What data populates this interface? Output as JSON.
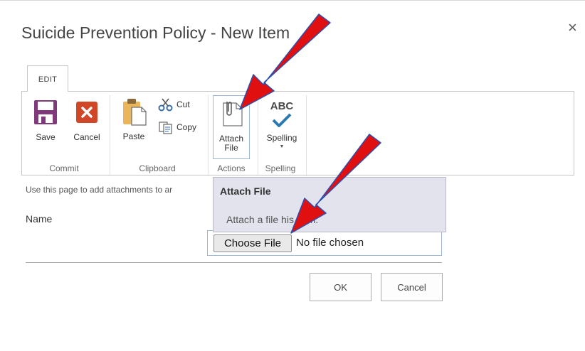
{
  "dialog": {
    "title": "Suicide Prevention Policy - New Item",
    "close_glyph": "×"
  },
  "ribbon": {
    "tab_label": "EDIT",
    "groups": {
      "commit": {
        "label": "Commit",
        "save_label": "Save",
        "cancel_label": "Cancel"
      },
      "clipboard": {
        "label": "Clipboard",
        "paste_label": "Paste",
        "cut_label": "Cut",
        "copy_label": "Copy"
      },
      "actions": {
        "label": "Actions",
        "attach_line1": "Attach",
        "attach_line2": "File"
      },
      "spelling": {
        "label": "Spelling",
        "button_label": "Spelling",
        "icon_text": "ABC"
      }
    }
  },
  "form": {
    "description": "Use this page to add attachments to ar",
    "name_label": "Name",
    "choose_file_label": "Choose File",
    "no_file_text": "No file chosen"
  },
  "tooltip": {
    "title": "Attach File",
    "body": "Attach a file    his item."
  },
  "buttons": {
    "ok_label": "OK",
    "cancel_label": "Cancel"
  },
  "colors": {
    "save_purple": "#80397b",
    "cancel_red": "#d04727",
    "check_blue": "#2a7ab0",
    "highlight_border": "#9bb6d6",
    "tooltip_bg": "#e3e3ed",
    "annotation_arrow": "#e01010"
  },
  "icons": {
    "save": "floppy-disk-icon",
    "cancel": "x-square-icon",
    "paste": "clipboard-icon",
    "cut": "scissors-icon",
    "copy": "copy-icon",
    "attach": "paperclip-document-icon",
    "spelling": "abc-check-icon",
    "close": "close-icon"
  }
}
